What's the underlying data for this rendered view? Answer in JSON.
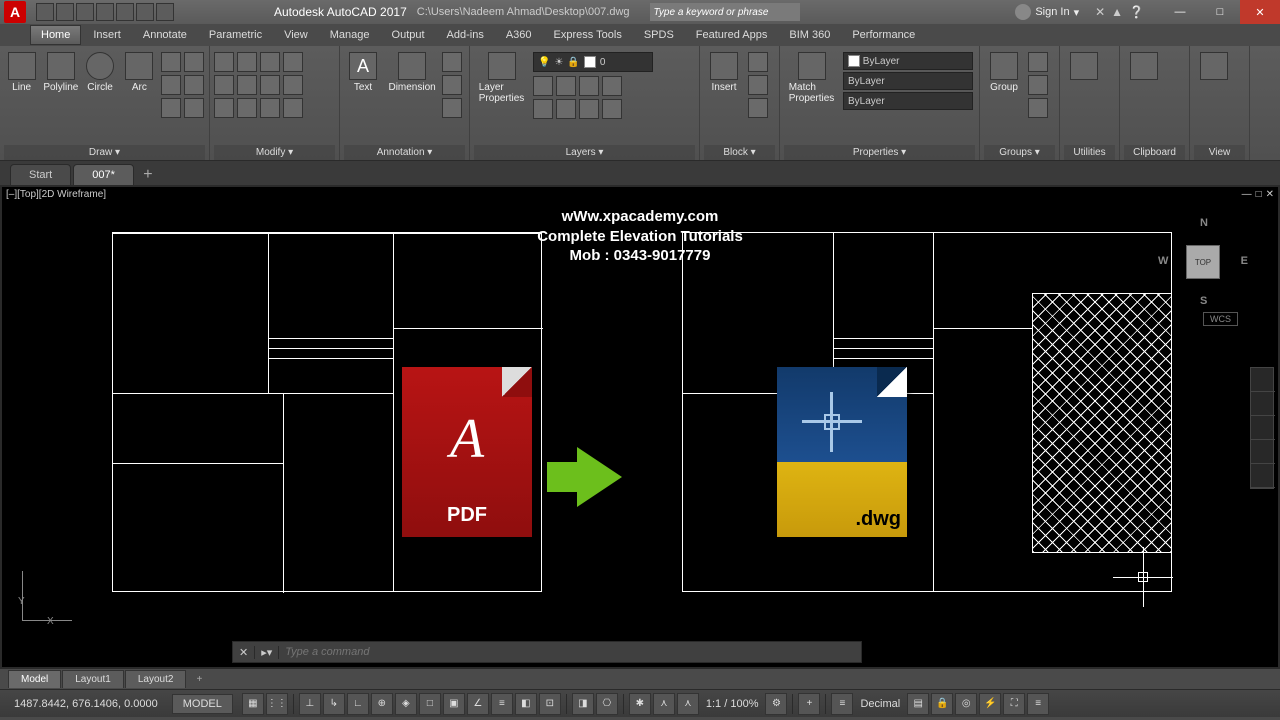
{
  "title": {
    "app": "Autodesk AutoCAD 2017",
    "path": "C:\\Users\\Nadeem Ahmad\\Desktop\\007.dwg",
    "logo_letter": "A"
  },
  "search": {
    "placeholder": "Type a keyword or phrase"
  },
  "signin": {
    "label": "Sign In"
  },
  "menus": [
    "Home",
    "Insert",
    "Annotate",
    "Parametric",
    "View",
    "Manage",
    "Output",
    "Add-ins",
    "A360",
    "Express Tools",
    "SPDS",
    "Featured Apps",
    "BIM 360",
    "Performance"
  ],
  "ribbon": {
    "draw": {
      "title": "Draw ▾",
      "btns": [
        "Line",
        "Polyline",
        "Circle",
        "Arc"
      ]
    },
    "modify": {
      "title": "Modify ▾"
    },
    "annotation": {
      "title": "Annotation ▾",
      "text": "Text",
      "dim": "Dimension"
    },
    "layers": {
      "title": "Layers ▾",
      "prop": "Layer\nProperties",
      "combo": "0"
    },
    "block": {
      "title": "Block ▾",
      "insert": "Insert"
    },
    "properties": {
      "title": "Properties ▾",
      "match": "Match\nProperties",
      "c1": "ByLayer",
      "c2": "ByLayer",
      "c3": "ByLayer"
    },
    "groups": {
      "title": "Groups ▾",
      "group": "Group"
    },
    "utilities": {
      "title": "Utilities"
    },
    "clipboard": {
      "title": "Clipboard"
    },
    "view": {
      "title": "View"
    }
  },
  "doc_tabs": {
    "start": "Start",
    "current": "007*",
    "add": "+"
  },
  "viewport": {
    "label": "[–][Top][2D Wireframe]",
    "min": "—",
    "max": "□",
    "close": "✕"
  },
  "banner": {
    "l1": "wWw.xpacademy.com",
    "l2": "Complete Elevation Tutorials",
    "l3": "Mob : 0343-9017779"
  },
  "pdf": {
    "label": "PDF",
    "a": "A"
  },
  "dwg": {
    "label": ".dwg"
  },
  "viewcube": {
    "n": "N",
    "s": "S",
    "e": "E",
    "w": "W",
    "face": "TOP",
    "wcs": "WCS"
  },
  "ucs": {
    "x": "X",
    "y": "Y"
  },
  "cmd": {
    "close": "✕",
    "prompt": "▸▾",
    "placeholder": "Type a command"
  },
  "bottom_tabs": [
    "Model",
    "Layout1",
    "Layout2"
  ],
  "status": {
    "coords": "1487.8442, 676.1406, 0.0000",
    "model": "MODEL",
    "scale": "1:1 / 100%",
    "units": "Decimal"
  },
  "win": {
    "min": "—",
    "max": "□",
    "close": "✕"
  }
}
